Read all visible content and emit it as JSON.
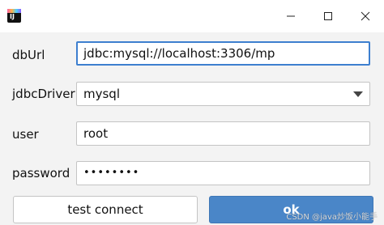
{
  "window": {
    "controls": {
      "minimize_icon": "minimize-icon",
      "maximize_icon": "maximize-icon",
      "close_icon": "close-icon"
    }
  },
  "form": {
    "dburl": {
      "label": "dbUrl",
      "value": "jdbc:mysql://localhost:3306/mp"
    },
    "driver": {
      "label": "jdbcDriver",
      "value": "mysql"
    },
    "user": {
      "label": "user",
      "value": "root"
    },
    "password": {
      "label": "password",
      "value": "••••••••"
    }
  },
  "buttons": {
    "test_connect": "test connect",
    "ok": "ok"
  },
  "watermark": "CSDN @java炒饭小能手",
  "colors": {
    "accent": "#4a86c8",
    "focus_border": "#3d7fcf",
    "background": "#f3f3f3"
  }
}
